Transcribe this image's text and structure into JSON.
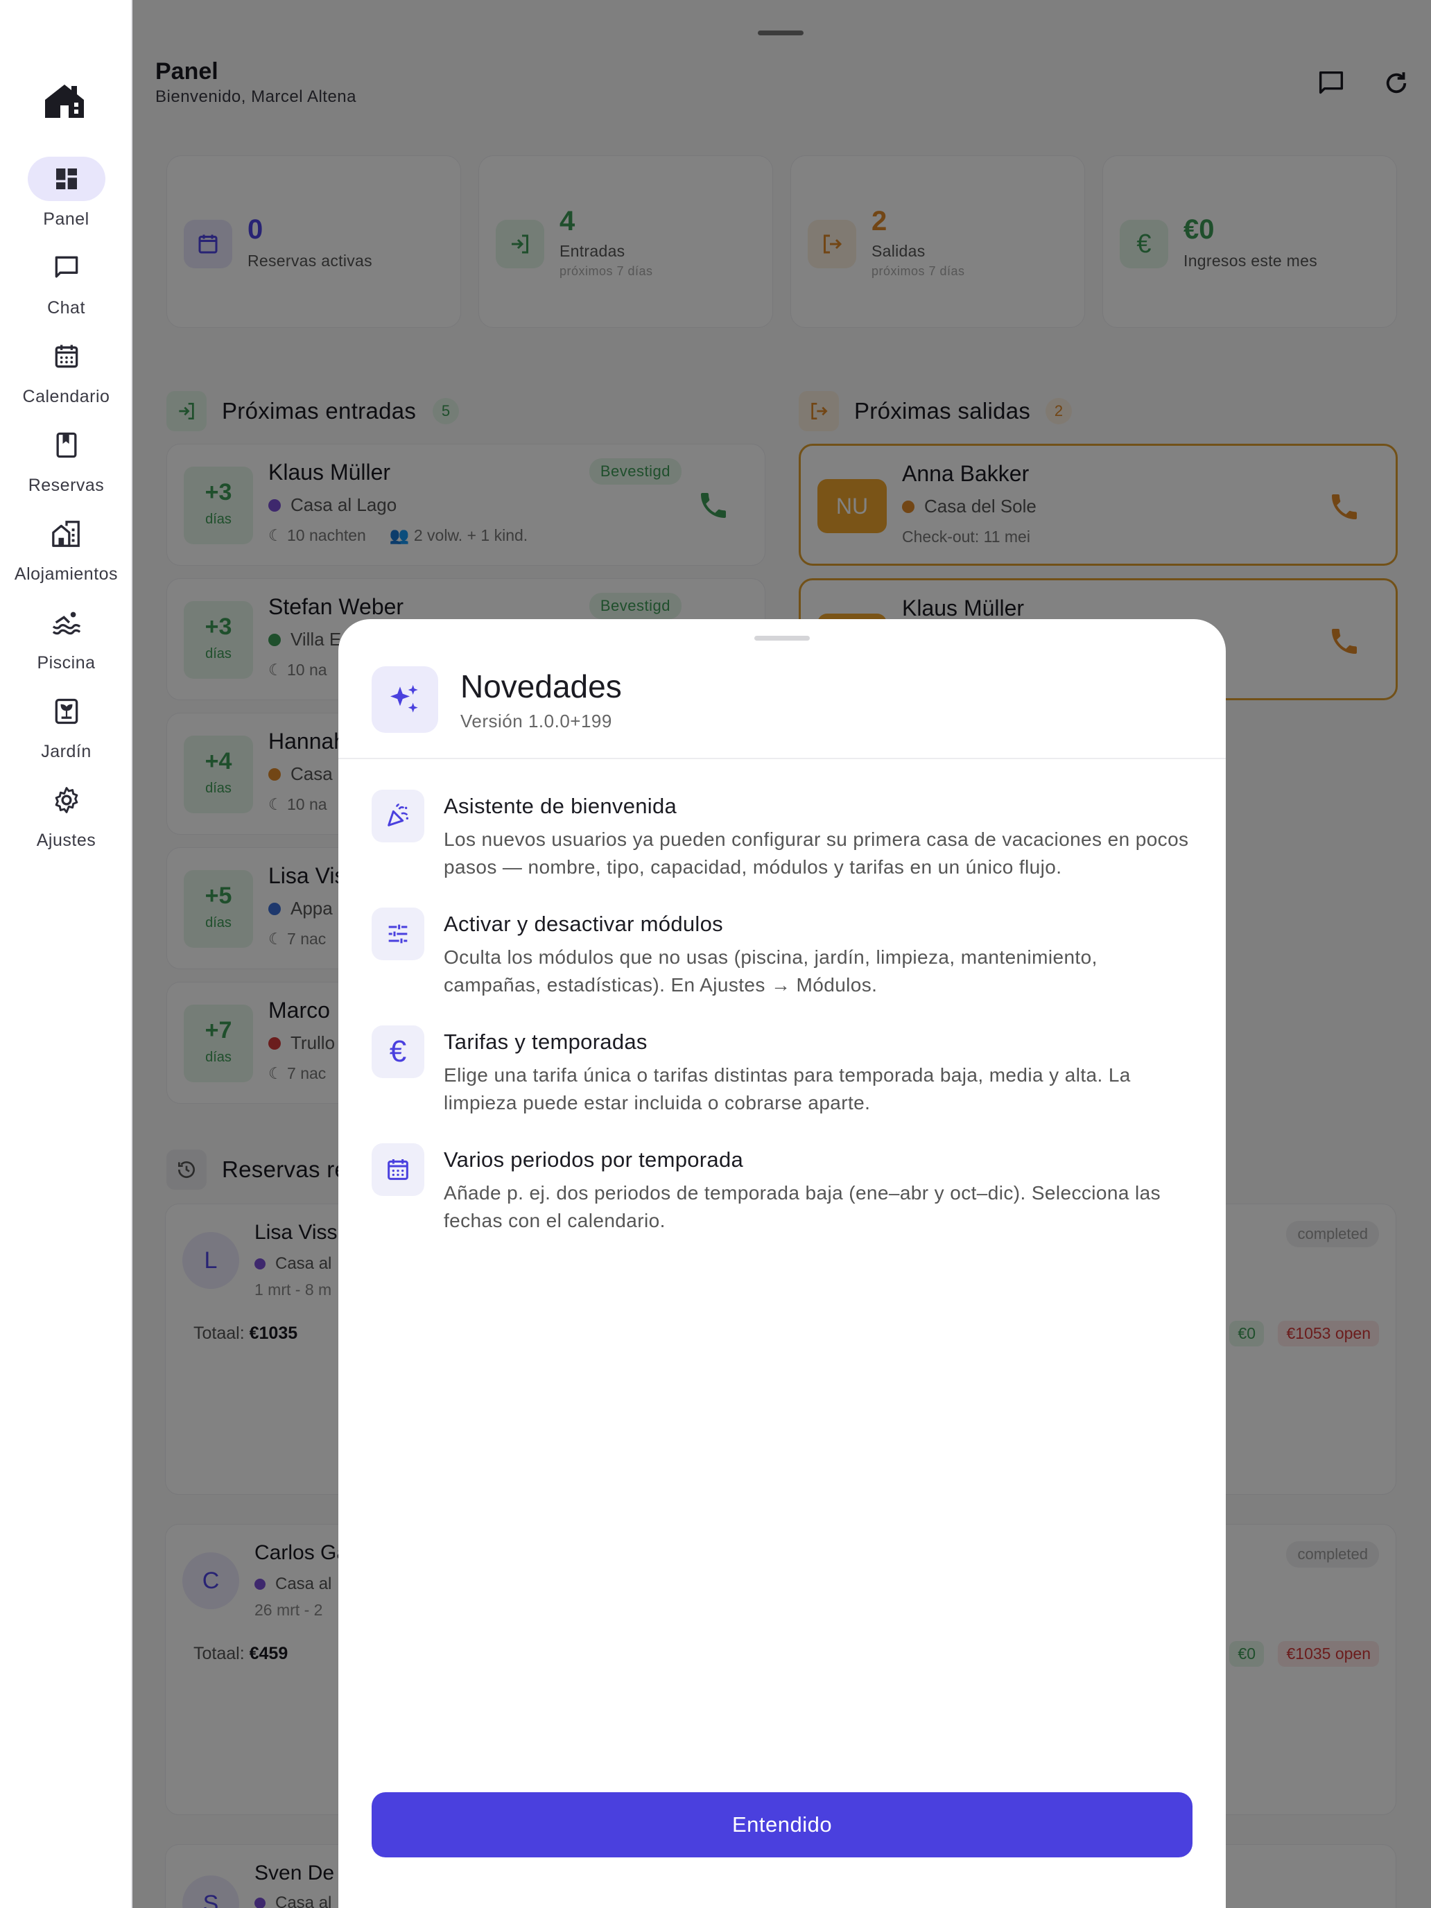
{
  "sidebar": {
    "logo_icon": "house-logo-icon",
    "items": [
      {
        "label": "Panel",
        "icon": "dashboard-icon",
        "active": true
      },
      {
        "label": "Chat",
        "icon": "chat-icon"
      },
      {
        "label": "Calendario",
        "icon": "calendar-icon"
      },
      {
        "label": "Reservas",
        "icon": "bookmark-icon"
      },
      {
        "label": "Alojamientos",
        "icon": "buildings-icon"
      },
      {
        "label": "Piscina",
        "icon": "pool-icon"
      },
      {
        "label": "Jardín",
        "icon": "garden-icon"
      },
      {
        "label": "Ajustes",
        "icon": "gear-icon"
      }
    ]
  },
  "header": {
    "title": "Panel",
    "subtitle": "Bienvenido, Marcel Altena"
  },
  "stats": [
    {
      "value": "0",
      "label": "Reservas activas",
      "sub": "",
      "color": "#5046e4",
      "icon": "calendar-icon"
    },
    {
      "value": "4",
      "label": "Entradas",
      "sub": "próximos 7 días",
      "color": "#3e9b56",
      "icon": "login-icon"
    },
    {
      "value": "2",
      "label": "Salidas",
      "sub": "próximos 7 días",
      "color": "#e0892a",
      "icon": "logout-icon"
    },
    {
      "value": "€0",
      "label": "Ingresos este mes",
      "sub": "",
      "color": "#3e9b56",
      "icon": "euro-icon"
    }
  ],
  "arrivals": {
    "title": "Próximas entradas",
    "count": "5",
    "items": [
      {
        "days": "+3",
        "days_label": "días",
        "name": "Klaus Müller",
        "property": "Casa al Lago",
        "dot": "#7b4fd6",
        "meta": "10 nachten",
        "guests": "2 volw. + 1 kind.",
        "status": "Bevestigd"
      },
      {
        "days": "+3",
        "days_label": "días",
        "name": "Stefan Weber",
        "property": "Villa E",
        "dot": "#3e9b56",
        "meta": "10 na",
        "status": "Bevestigd"
      },
      {
        "days": "+4",
        "days_label": "días",
        "name": "Hannah",
        "property": "Casa",
        "dot": "#e0892a",
        "meta": "10 na"
      },
      {
        "days": "+5",
        "days_label": "días",
        "name": "Lisa Vis",
        "property": "Appa",
        "dot": "#3b6fd6",
        "meta": "7 nac"
      },
      {
        "days": "+7",
        "days_label": "días",
        "name": "Marco",
        "property": "Trullo",
        "dot": "#d33a3a",
        "meta": "7 nac"
      }
    ]
  },
  "departures": {
    "title": "Próximas salidas",
    "count": "2",
    "items": [
      {
        "initials": "NU",
        "name": "Anna Bakker",
        "property": "Casa del Sole",
        "dot": "#e0892a",
        "checkout": "Check-out: 11 mei"
      },
      {
        "initials": "",
        "name": "Klaus Müller",
        "property": "",
        "dot": "#e0892a",
        "checkout": ""
      }
    ]
  },
  "recent": {
    "title": "Reservas re",
    "items": [
      {
        "initial": "L",
        "name": "Lisa Viss",
        "property": "Casa al",
        "dates": "1 mrt - 8 m",
        "status": "completed",
        "total_label": "Totaal:",
        "total": "€1035",
        "paid": "€0",
        "open": "€1053 open"
      },
      {
        "initial": "C",
        "name": "Carlos Ga",
        "property": "Casa al",
        "dates": "26 mrt - 2",
        "status": "completed",
        "total_label": "Totaal:",
        "total": "€459",
        "paid": "€0",
        "open": "€1035 open"
      },
      {
        "initial": "S",
        "name": "Sven De",
        "property": "Casa al",
        "dates": "",
        "status": "",
        "total_label": "",
        "total": "",
        "paid": "",
        "open": ""
      }
    ]
  },
  "modal": {
    "title": "Novedades",
    "version": "Versión 1.0.0+199",
    "icon": "sparkles-icon",
    "features": [
      {
        "icon": "party-popper-icon",
        "title": "Asistente de bienvenida",
        "description": "Los nuevos usuarios ya pueden configurar su primera casa de vacaciones en pocos pasos — nombre, tipo, capacidad, módulos y tarifas en un único flujo."
      },
      {
        "icon": "sliders-icon",
        "title": "Activar y desactivar módulos",
        "description": "Oculta los módulos que no usas (piscina, jardín, limpieza, mantenimiento, campañas, estadísticas). En Ajustes → Módulos."
      },
      {
        "icon": "euro-icon",
        "title": "Tarifas y temporadas",
        "description": "Elige una tarifa única o tarifas distintas para temporada baja, media y alta. La limpieza puede estar incluida o cobrarse aparte."
      },
      {
        "icon": "calendar-icon",
        "title": "Varios periodos por temporada",
        "description": "Añade p. ej. dos periodos de temporada baja (ene–abr y oct–dic). Selecciona las fechas con el calendario."
      }
    ],
    "confirm_label": "Entendido"
  },
  "colors": {
    "accent": "#4a40de",
    "green": "#3e9b56",
    "orange": "#e0892a",
    "red": "#d33a3a"
  }
}
